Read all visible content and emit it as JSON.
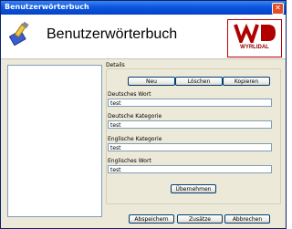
{
  "window": {
    "title": "Benutzerwörterbuch"
  },
  "header": {
    "app_title": "Benutzerwörterbuch",
    "logo_text": "WYRLIDAL"
  },
  "details": {
    "group_label": "Details",
    "buttons": {
      "new": "Neu",
      "delete": "Löschen",
      "copy": "Kopieren"
    },
    "fields": [
      {
        "label": "Deutsches Wort",
        "value": "test"
      },
      {
        "label": "Deutsche Kategorie",
        "value": "test"
      },
      {
        "label": "Englische Kategorie",
        "value": "test"
      },
      {
        "label": "Englisches Wort",
        "value": "test"
      }
    ],
    "apply_label": "Übernehmen"
  },
  "footer": {
    "save": "Abspeichern",
    "extras": "Zusätze",
    "cancel": "Abbrechen"
  },
  "colors": {
    "titlebar": "#0a55e0",
    "logo_red": "#b00000",
    "close": "#e24c25"
  }
}
